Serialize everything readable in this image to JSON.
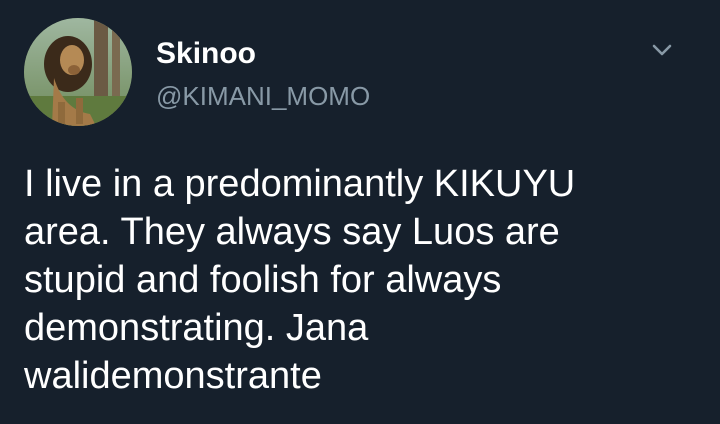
{
  "user": {
    "display_name": "Skinoo",
    "handle": "@KIMANI_MOMO",
    "avatar_icon": "lion-avatar"
  },
  "tweet": {
    "lines": [
      "I live in a predominantly KIKUYU",
      "area. They always say Luos are",
      "stupid and foolish for always",
      "demonstrating. Jana",
      "walidemonstrante"
    ]
  },
  "menu": {
    "icon": "chevron-down-icon"
  },
  "colors": {
    "background": "#16202c",
    "text": "#ffffff",
    "secondary_text": "#8899a6"
  }
}
